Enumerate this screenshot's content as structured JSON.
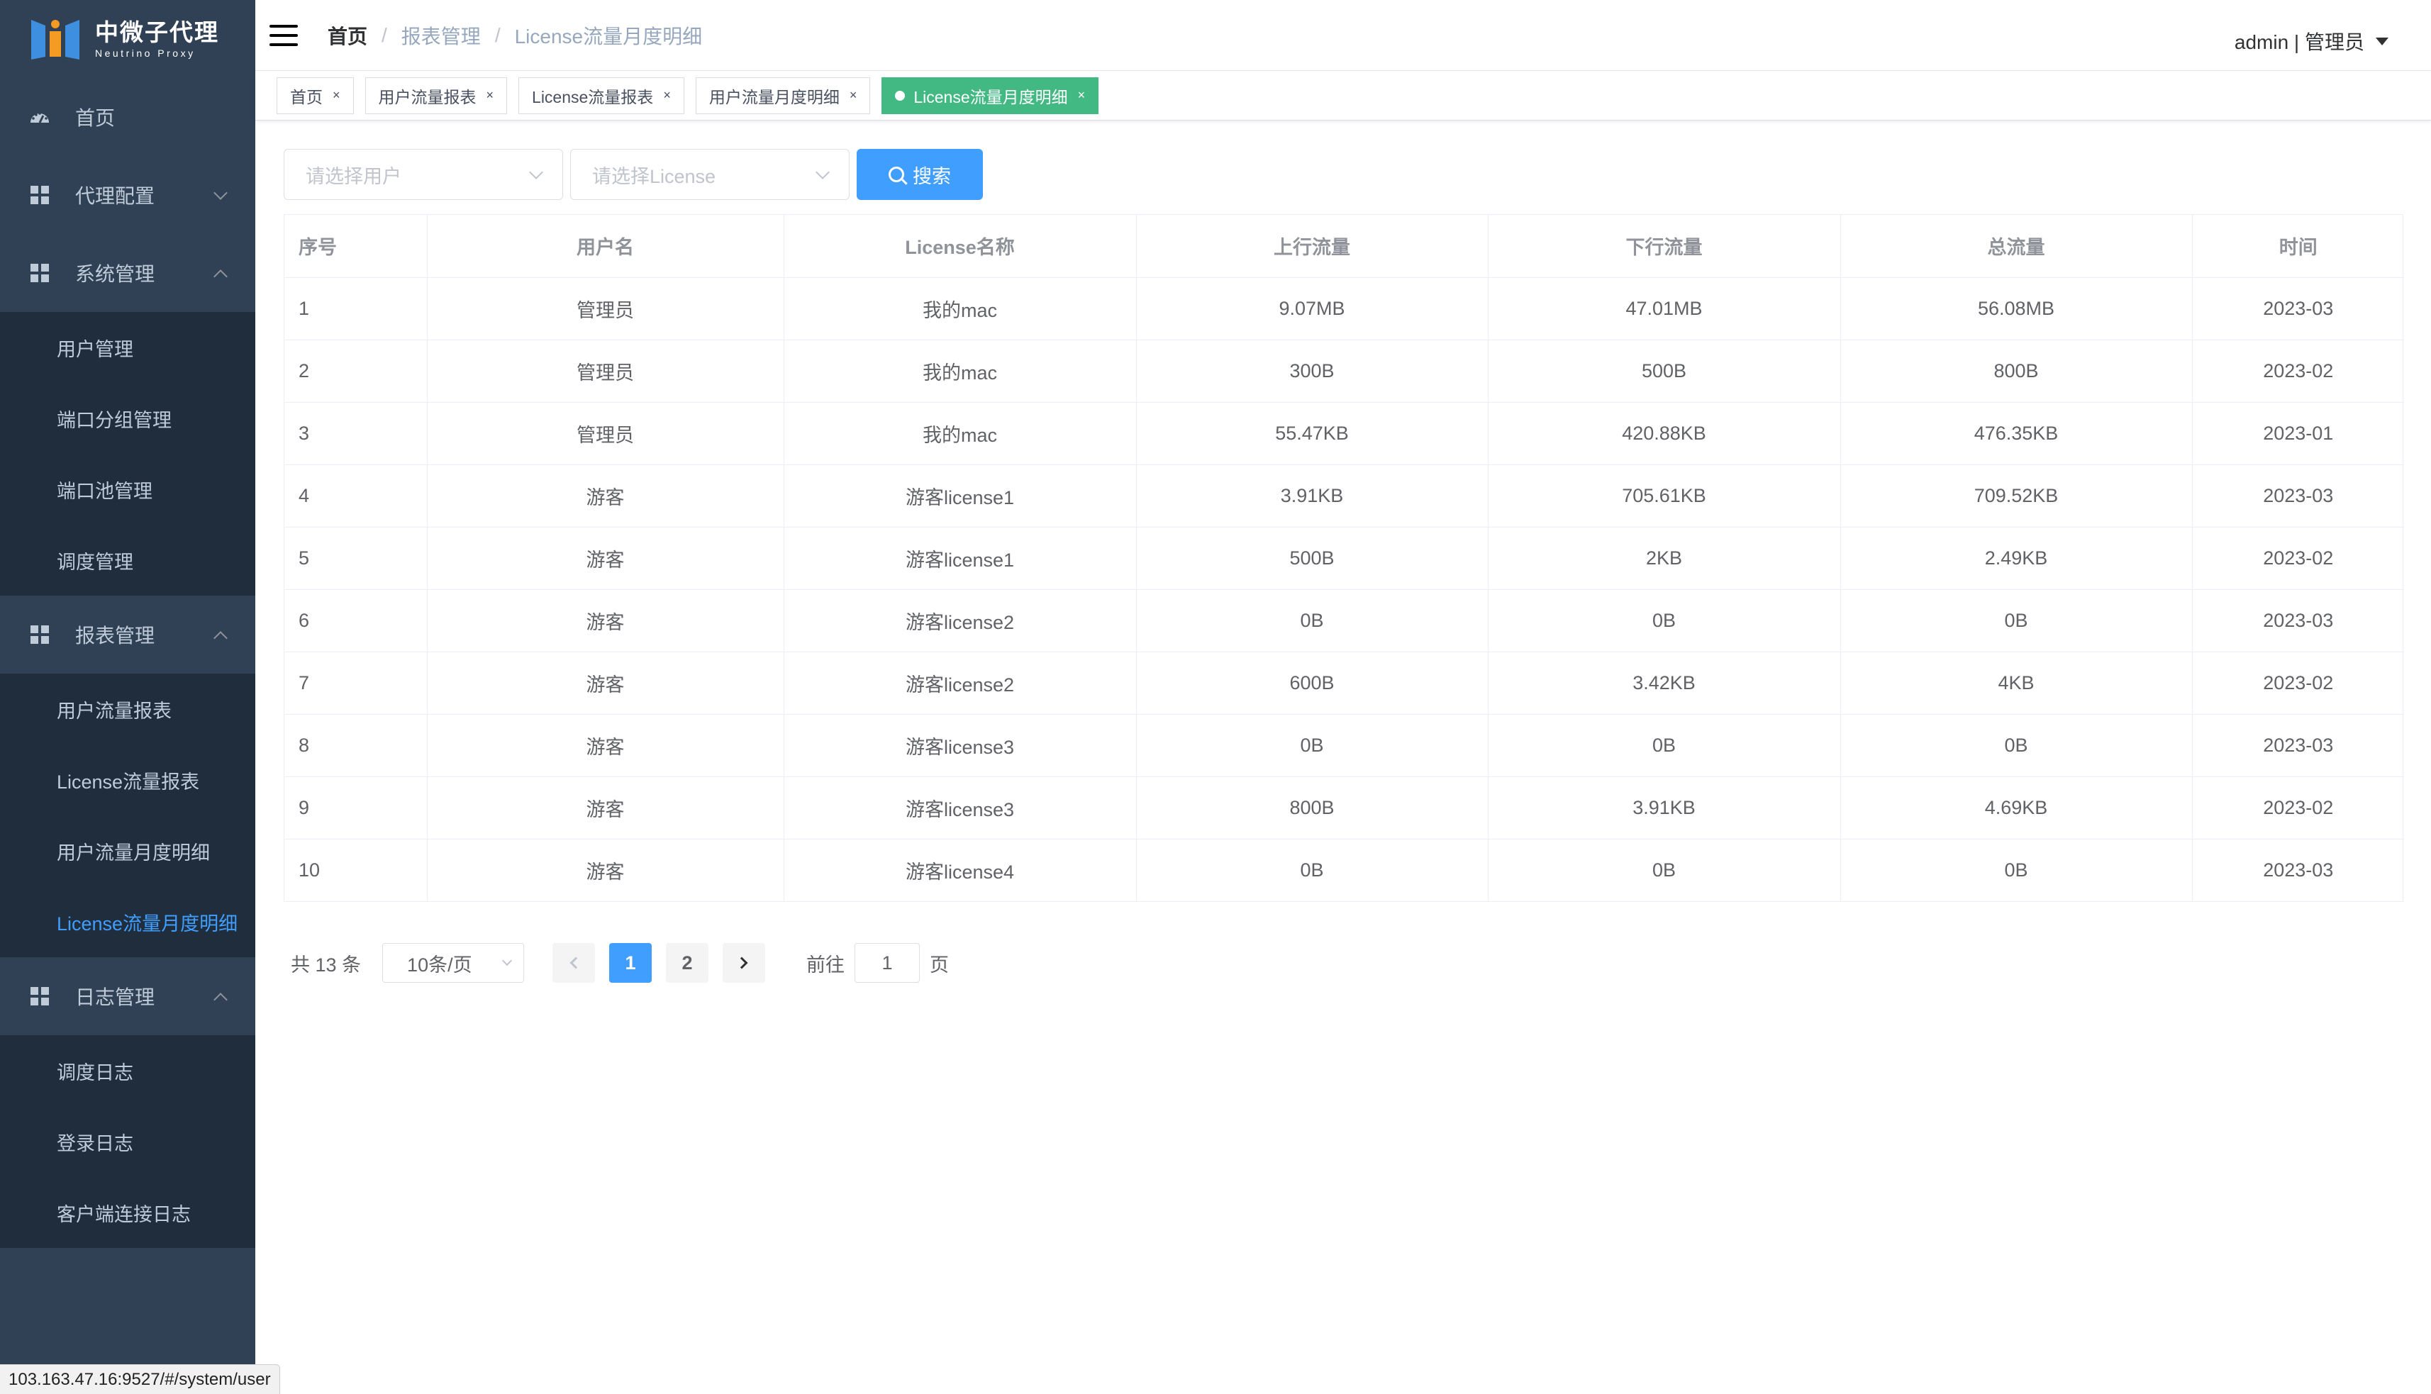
{
  "brand": {
    "title": "中微子代理",
    "subtitle": "Neutrino Proxy",
    "colors": {
      "primary": "#409eff",
      "sidebar": "#304156",
      "submenu": "#1f2d3d",
      "tag_active": "#42b983"
    }
  },
  "sidebar": {
    "home": "首页",
    "proxy_config": "代理配置",
    "system_mgmt": "系统管理",
    "system_items": [
      "用户管理",
      "端口分组管理",
      "端口池管理",
      "调度管理"
    ],
    "report_mgmt": "报表管理",
    "report_items": [
      "用户流量报表",
      "License流量报表",
      "用户流量月度明细",
      "License流量月度明细"
    ],
    "log_mgmt": "日志管理",
    "log_items": [
      "调度日志",
      "登录日志",
      "客户端连接日志"
    ]
  },
  "header": {
    "breadcrumb": [
      "首页",
      "报表管理",
      "License流量月度明细"
    ],
    "separator": "/",
    "user": "admin | 管理员"
  },
  "tags": [
    {
      "label": "首页",
      "close": "×"
    },
    {
      "label": "用户流量报表",
      "close": "×"
    },
    {
      "label": "License流量报表",
      "close": "×"
    },
    {
      "label": "用户流量月度明细",
      "close": "×"
    },
    {
      "label": "License流量月度明细",
      "close": "×",
      "active": true
    }
  ],
  "filters": {
    "user_placeholder": "请选择用户",
    "license_placeholder": "请选择License",
    "search_label": "搜索"
  },
  "table": {
    "columns": [
      "序号",
      "用户名",
      "License名称",
      "上行流量",
      "下行流量",
      "总流量",
      "时间"
    ],
    "rows": [
      [
        "1",
        "管理员",
        "我的mac",
        "9.07MB",
        "47.01MB",
        "56.08MB",
        "2023-03"
      ],
      [
        "2",
        "管理员",
        "我的mac",
        "300B",
        "500B",
        "800B",
        "2023-02"
      ],
      [
        "3",
        "管理员",
        "我的mac",
        "55.47KB",
        "420.88KB",
        "476.35KB",
        "2023-01"
      ],
      [
        "4",
        "游客",
        "游客license1",
        "3.91KB",
        "705.61KB",
        "709.52KB",
        "2023-03"
      ],
      [
        "5",
        "游客",
        "游客license1",
        "500B",
        "2KB",
        "2.49KB",
        "2023-02"
      ],
      [
        "6",
        "游客",
        "游客license2",
        "0B",
        "0B",
        "0B",
        "2023-03"
      ],
      [
        "7",
        "游客",
        "游客license2",
        "600B",
        "3.42KB",
        "4KB",
        "2023-02"
      ],
      [
        "8",
        "游客",
        "游客license3",
        "0B",
        "0B",
        "0B",
        "2023-03"
      ],
      [
        "9",
        "游客",
        "游客license3",
        "800B",
        "3.91KB",
        "4.69KB",
        "2023-02"
      ],
      [
        "10",
        "游客",
        "游客license4",
        "0B",
        "0B",
        "0B",
        "2023-03"
      ]
    ]
  },
  "pagination": {
    "total_text": "共 13 条",
    "page_size": "10条/页",
    "pages": [
      "1",
      "2"
    ],
    "current_page": "1",
    "goto_label": "前往",
    "goto_value": "1",
    "goto_suffix": "页"
  },
  "statusbar": {
    "url": "103.163.47.16:9527/#/system/user"
  }
}
